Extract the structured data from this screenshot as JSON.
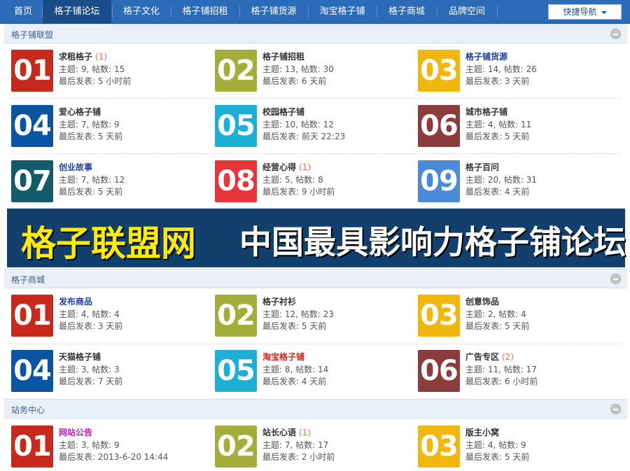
{
  "nav": {
    "items": [
      "首页",
      "格子铺论坛",
      "格子文化",
      "格子铺招租",
      "格子铺货源",
      "淘宝格子铺",
      "格子商城",
      "品牌空间"
    ],
    "active_index": 1,
    "quick_nav_label": "快捷导航"
  },
  "colors": {
    "nav_bg": "#2b6bb7",
    "nav_active": "#1a4c8a",
    "tile_red": "#c72a1c",
    "tile_olive": "#a4ad3a",
    "tile_yellow": "#f0b70d",
    "tile_blue": "#0a54a4",
    "tile_cyan": "#1bb0d4",
    "tile_brown": "#8c3c3c",
    "tile_teal": "#155a6b",
    "tile_pink": "#e8353a",
    "tile_sky": "#4a8ad6",
    "banner_bg": "#123f6c",
    "banner_yellow": "#ffec00"
  },
  "sections": [
    {
      "title": "格子铺联盟",
      "forums": [
        {
          "num": "01",
          "color": "#c72a1c",
          "name": "求租格子",
          "name_color": "#333333",
          "new_count": "(1)",
          "stats": "主题: 9, 帖数: 15",
          "last": "最后发表: 5 小时前"
        },
        {
          "num": "02",
          "color": "#a4ad3a",
          "name": "格子铺招租",
          "name_color": "#333333",
          "new_count": "",
          "stats": "主题: 13, 帖数: 30",
          "last": "最后发表: 6 天前"
        },
        {
          "num": "03",
          "color": "#f0b70d",
          "name": "格子铺货源",
          "name_color": "#1d3ea8",
          "new_count": "",
          "stats": "主题: 14, 帖数: 26",
          "last": "最后发表: 3 天前"
        },
        {
          "num": "04",
          "color": "#0a54a4",
          "name": "爱心格子铺",
          "name_color": "#333333",
          "new_count": "",
          "stats": "主题: 7, 帖数: 9",
          "last": "最后发表: 5 天前"
        },
        {
          "num": "05",
          "color": "#1bb0d4",
          "name": "校园格子铺",
          "name_color": "#333333",
          "new_count": "",
          "stats": "主题: 10, 帖数: 12",
          "last": "最后发表: 前天 22:23"
        },
        {
          "num": "06",
          "color": "#8c3c3c",
          "name": "城市格子铺",
          "name_color": "#333333",
          "new_count": "",
          "stats": "主题: 4, 帖数: 11",
          "last": "最后发表: 5 天前"
        },
        {
          "num": "07",
          "color": "#155a6b",
          "name": "创业故事",
          "name_color": "#1d3ea8",
          "new_count": "",
          "stats": "主题: 7, 帖数: 12",
          "last": "最后发表: 5 天前"
        },
        {
          "num": "08",
          "color": "#e8353a",
          "name": "经营心得",
          "name_color": "#333333",
          "new_count": "(1)",
          "stats": "主题: 5, 帖数: 8",
          "last": "最后发表: 9 小时前"
        },
        {
          "num": "09",
          "color": "#4a8ad6",
          "name": "格子百问",
          "name_color": "#333333",
          "new_count": "",
          "stats": "主题: 20, 帖数: 31",
          "last": "最后发表: 4 天前"
        }
      ]
    },
    {
      "title": "格子商城",
      "forums": [
        {
          "num": "01",
          "color": "#c72a1c",
          "name": "发布商品",
          "name_color": "#1d3ea8",
          "new_count": "",
          "stats": "主题: 4, 帖数: 4",
          "last": "最后发表: 3 天前"
        },
        {
          "num": "02",
          "color": "#a4ad3a",
          "name": "格子衬衫",
          "name_color": "#333333",
          "new_count": "",
          "stats": "主题: 12, 帖数: 23",
          "last": "最后发表: 5 天前"
        },
        {
          "num": "03",
          "color": "#f0b70d",
          "name": "创意饰品",
          "name_color": "#333333",
          "new_count": "",
          "stats": "主题: 2, 帖数: 4",
          "last": "最后发表: 5 天前"
        },
        {
          "num": "04",
          "color": "#0a54a4",
          "name": "天猫格子铺",
          "name_color": "#333333",
          "new_count": "",
          "stats": "主题: 3, 帖数: 3",
          "last": "最后发表: 7 天前"
        },
        {
          "num": "05",
          "color": "#1bb0d4",
          "name": "淘宝格子铺",
          "name_color": "#d0241b",
          "new_count": "",
          "stats": "主题: 8, 帖数: 14",
          "last": "最后发表: 4 天前"
        },
        {
          "num": "06",
          "color": "#8c3c3c",
          "name": "广告专区",
          "name_color": "#333333",
          "new_count": "(2)",
          "stats": "主题: 11, 帖数: 17",
          "last": "最后发表: 6 小时前"
        }
      ]
    },
    {
      "title": "站务中心",
      "forums": [
        {
          "num": "01",
          "color": "#c72a1c",
          "name": "网站公告",
          "name_color": "#c218c2",
          "new_count": "",
          "stats": "主题: 3, 帖数: 9",
          "last": "最后发表: 2013-6-20 14:44"
        },
        {
          "num": "02",
          "color": "#a4ad3a",
          "name": "站长心语",
          "name_color": "#333333",
          "new_count": "(1)",
          "stats": "主题: 7, 帖数: 17",
          "last": "最后发表: 2 小时前"
        },
        {
          "num": "03",
          "color": "#f0b70d",
          "name": "版主小窝",
          "name_color": "#333333",
          "new_count": "",
          "stats": "主题: 4, 帖数: 9",
          "last": "最后发表: 5 天前"
        }
      ]
    }
  ],
  "banner": {
    "left_text": "格子联盟网",
    "right_text": "中国最具影响力格子铺论坛"
  }
}
